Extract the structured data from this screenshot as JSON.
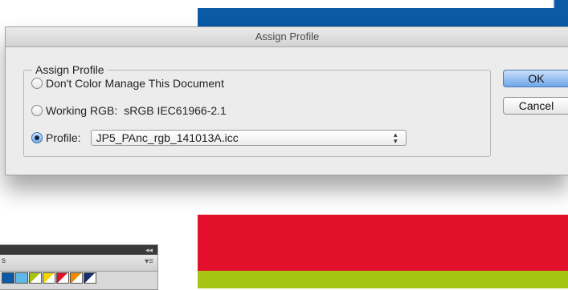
{
  "dialog": {
    "title": "Assign Profile",
    "group_title": "Assign Profile",
    "options": [
      {
        "label": "Don't Color Manage This Document",
        "selected": false
      },
      {
        "label": "Working RGB:",
        "value": "sRGB IEC61966-2.1",
        "selected": false
      },
      {
        "label": "Profile:",
        "selected": true
      }
    ],
    "profile_select": {
      "value": "JP5_PAnc_rgb_141013A.icc"
    },
    "buttons": {
      "ok": "OK",
      "cancel": "Cancel"
    }
  },
  "panel": {
    "collapse_glyph": "◂◂",
    "tab_label": "s",
    "menu_glyph": "▾≡"
  },
  "colors": {
    "blue_band": "#0a5aa6",
    "red_band": "#e2102a",
    "green_band": "#a6c512",
    "ok_button": "#6fa6ea"
  }
}
